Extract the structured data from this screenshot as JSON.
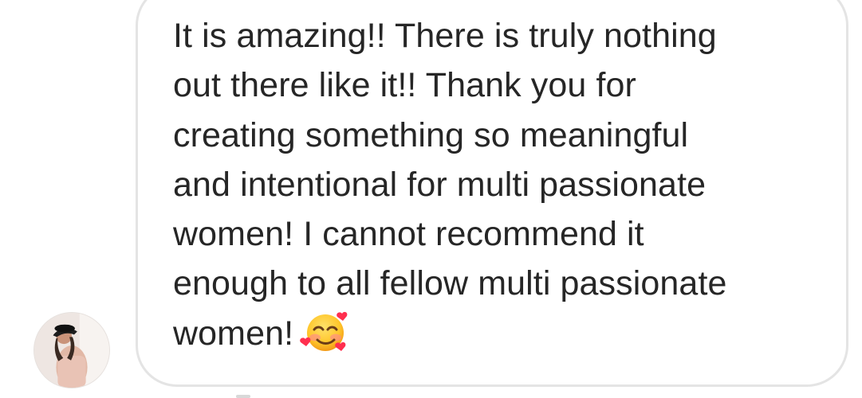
{
  "message": {
    "line_1": "It is amazing!! There is truly nothing",
    "line_2": "out there like it!! Thank you for",
    "line_3": "creating something so meaningful",
    "line_4": "and intentional for multi passionate",
    "line_5": "women! I cannot recommend it",
    "line_6": "enough to all fellow multi passionate",
    "line_7": "women!",
    "emoji_name": "smiling-face-with-hearts-icon"
  },
  "avatar": {
    "icon_name": "avatar-icon"
  }
}
